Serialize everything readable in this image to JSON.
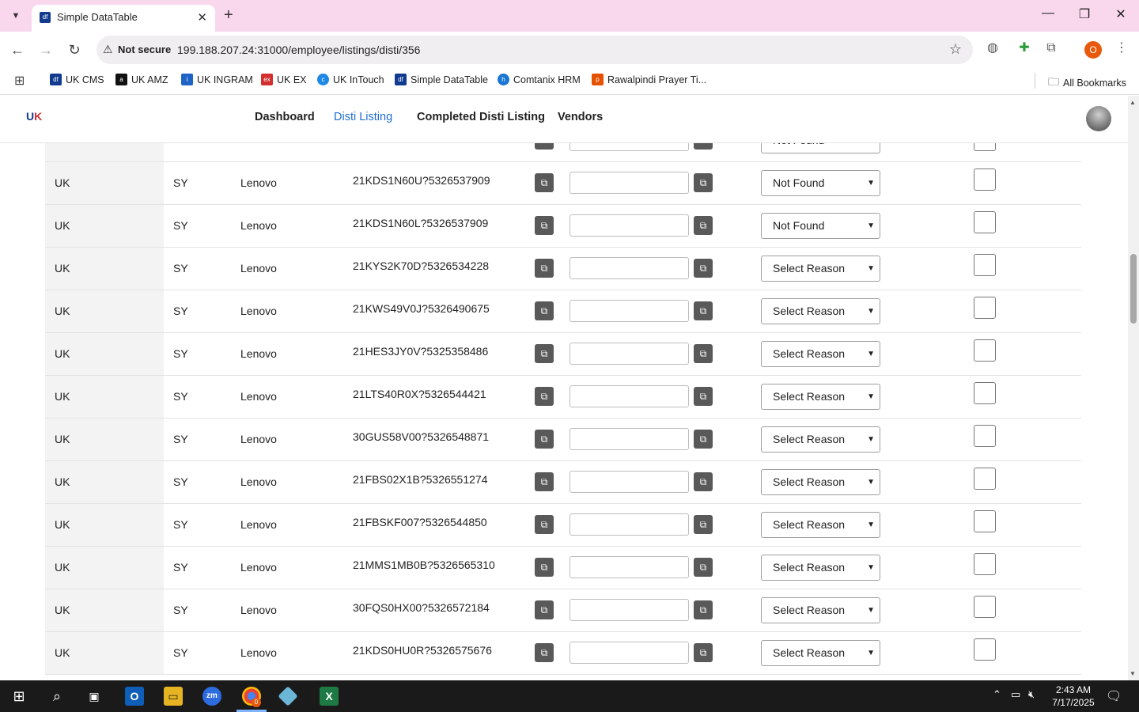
{
  "browser": {
    "tab_title": "Simple DataTable",
    "tab_favicon": "df",
    "url_security": "Not secure",
    "url": "199.188.207.24:31000/employee/listings/disti/356",
    "profile_initial": "O",
    "bookmarks": [
      {
        "label": "UK CMS",
        "color": "#123b8f",
        "icon": "df"
      },
      {
        "label": "UK AMZ",
        "color": "#111111",
        "icon": "a"
      },
      {
        "label": "UK INGRAM",
        "color": "#1e63c6",
        "icon": "i"
      },
      {
        "label": "UK EX",
        "color": "#d32f2f",
        "icon": "ex"
      },
      {
        "label": "UK InTouch",
        "color": "#1e88e5",
        "icon": "c"
      },
      {
        "label": "Simple DataTable",
        "color": "#123b8f",
        "icon": "df"
      },
      {
        "label": "Comtanix HRM",
        "color": "#1976d2",
        "icon": "h"
      },
      {
        "label": "Rawalpindi Prayer Ti...",
        "color": "#e65100",
        "icon": "p"
      }
    ],
    "all_bookmarks": "All Bookmarks"
  },
  "nav": {
    "links": [
      "Dashboard",
      "Disti Listing",
      "Completed Disti Listing",
      "Vendors"
    ],
    "active": "Disti Listing"
  },
  "partial_row": {
    "reason": "Not Found"
  },
  "rows": [
    {
      "country": "UK",
      "code": "SY",
      "brand": "Lenovo",
      "sku": "21KDS1N60U?5326537909",
      "reason": "Not Found"
    },
    {
      "country": "UK",
      "code": "SY",
      "brand": "Lenovo",
      "sku": "21KDS1N60L?5326537909",
      "reason": "Not Found"
    },
    {
      "country": "UK",
      "code": "SY",
      "brand": "Lenovo",
      "sku": "21KYS2K70D?5326534228",
      "reason": "Select Reason"
    },
    {
      "country": "UK",
      "code": "SY",
      "brand": "Lenovo",
      "sku": "21KWS49V0J?5326490675",
      "reason": "Select Reason"
    },
    {
      "country": "UK",
      "code": "SY",
      "brand": "Lenovo",
      "sku": "21HES3JY0V?5325358486",
      "reason": "Select Reason"
    },
    {
      "country": "UK",
      "code": "SY",
      "brand": "Lenovo",
      "sku": "21LTS40R0X?5326544421",
      "reason": "Select Reason"
    },
    {
      "country": "UK",
      "code": "SY",
      "brand": "Lenovo",
      "sku": "30GUS58V00?5326548871",
      "reason": "Select Reason"
    },
    {
      "country": "UK",
      "code": "SY",
      "brand": "Lenovo",
      "sku": "21FBS02X1B?5326551274",
      "reason": "Select Reason"
    },
    {
      "country": "UK",
      "code": "SY",
      "brand": "Lenovo",
      "sku": "21FBSKF007?5326544850",
      "reason": "Select Reason"
    },
    {
      "country": "UK",
      "code": "SY",
      "brand": "Lenovo",
      "sku": "21MMS1MB0B?5326565310",
      "reason": "Select Reason"
    },
    {
      "country": "UK",
      "code": "SY",
      "brand": "Lenovo",
      "sku": "30FQS0HX00?5326572184",
      "reason": "Select Reason"
    },
    {
      "country": "UK",
      "code": "SY",
      "brand": "Lenovo",
      "sku": "21KDS0HU0R?5326575676",
      "reason": "Select Reason"
    }
  ],
  "taskbar": {
    "time": "2:43 AM",
    "date": "7/17/2025",
    "chrome_badge": "0"
  }
}
